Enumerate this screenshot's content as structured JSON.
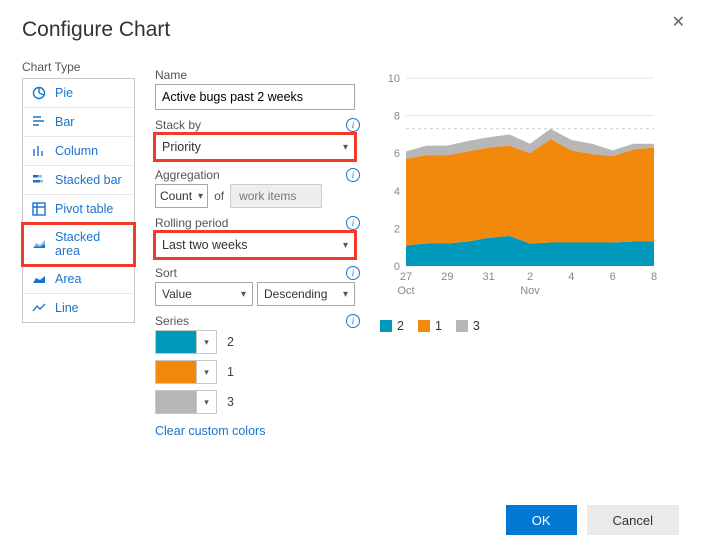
{
  "title": "Configure Chart",
  "sidebar_label": "Chart Type",
  "chart_types": [
    {
      "label": "Pie",
      "icon": "pie-icon"
    },
    {
      "label": "Bar",
      "icon": "bar-icon"
    },
    {
      "label": "Column",
      "icon": "column-icon"
    },
    {
      "label": "Stacked bar",
      "icon": "stacked-bar-icon"
    },
    {
      "label": "Pivot table",
      "icon": "pivot-table-icon"
    },
    {
      "label": "Stacked area",
      "icon": "stacked-area-icon"
    },
    {
      "label": "Area",
      "icon": "area-icon"
    },
    {
      "label": "Line",
      "icon": "line-icon"
    }
  ],
  "selected_chart_type_index": 5,
  "fields": {
    "name_label": "Name",
    "name_value": "Active bugs past 2 weeks",
    "stack_by_label": "Stack by",
    "stack_by_value": "Priority",
    "aggregation_label": "Aggregation",
    "aggregation_value": "Count",
    "aggregation_of": "of",
    "aggregation_target": "work items",
    "rolling_label": "Rolling period",
    "rolling_value": "Last two weeks",
    "sort_label": "Sort",
    "sort_value": "Value",
    "sort_dir": "Descending",
    "series_label": "Series",
    "clear_colors": "Clear custom colors"
  },
  "series": [
    {
      "label": "2",
      "color": "#0099bc"
    },
    {
      "label": "1",
      "color": "#f2880c"
    },
    {
      "label": "3",
      "color": "#b7b7b7"
    }
  ],
  "chart_data": {
    "type": "area",
    "stacked": true,
    "ylim": [
      0,
      10
    ],
    "yticks": [
      0,
      2,
      4,
      6,
      8,
      10
    ],
    "x_categories": [
      "27",
      "29",
      "31",
      "2",
      "4",
      "6",
      "8"
    ],
    "x_group_labels": {
      "0": "Oct",
      "3": "Nov"
    },
    "threshold": 7.3,
    "series": [
      {
        "name": "2",
        "color": "#0099bc",
        "values": [
          1.1,
          1.2,
          1.2,
          1.3,
          1.5,
          1.6,
          1.2,
          1.25,
          1.25,
          1.25,
          1.25,
          1.3,
          1.3
        ]
      },
      {
        "name": "1",
        "color": "#f2880c",
        "values": [
          4.6,
          4.7,
          4.7,
          4.8,
          4.8,
          4.8,
          4.8,
          5.5,
          4.9,
          4.7,
          4.6,
          4.9,
          5.0
        ]
      },
      {
        "name": "3",
        "color": "#b7b7b7",
        "values": [
          0.4,
          0.5,
          0.5,
          0.55,
          0.55,
          0.6,
          0.5,
          0.55,
          0.55,
          0.55,
          0.3,
          0.3,
          0.2
        ]
      }
    ]
  },
  "ok_label": "OK",
  "cancel_label": "Cancel"
}
